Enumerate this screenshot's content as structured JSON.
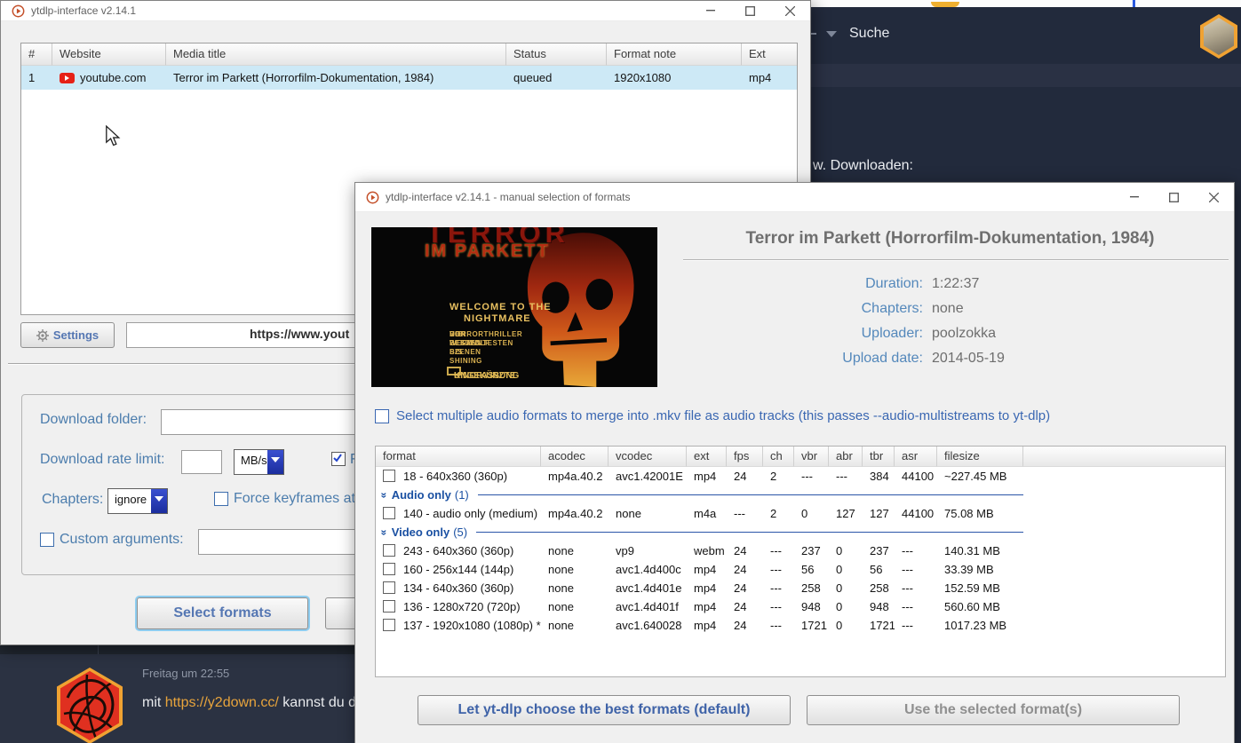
{
  "main_window": {
    "title": "ytdlp-interface v2.14.1",
    "queue_table": {
      "headers": [
        "#",
        "Website",
        "Media title",
        "Status",
        "Format note",
        "Ext"
      ],
      "rows": [
        {
          "num": "1",
          "website": "youtube.com",
          "title": "Terror im Parkett (Horrorfilm-Dokumentation, 1984)",
          "status": "queued",
          "format_note": "1920x1080",
          "ext": "mp4"
        }
      ]
    },
    "settings_button": "Settings",
    "url_fragment": "https://www.yout",
    "download_folder_label": "Download folder:",
    "rate_limit_label": "Download rate limit:",
    "rate_unit": "MB/s",
    "rate_checkbox_fragment": "F",
    "chapters_label": "Chapters:",
    "chapters_value": "ignore",
    "keyframes_label": "Force keyframes at c",
    "custom_args_label": "Custom arguments:",
    "select_formats_button": "Select formats"
  },
  "formats_window": {
    "title": "ytdlp-interface v2.14.1 - manual selection of formats",
    "video_title": "Terror im Parkett (Horrorfilm-Dokumentation, 1984)",
    "meta": [
      {
        "label": "Duration:",
        "value": "1:22:37"
      },
      {
        "label": "Chapters:",
        "value": "none"
      },
      {
        "label": "Uploader:",
        "value": "poolzokka"
      },
      {
        "label": "Upload date:",
        "value": "2014-05-19"
      }
    ],
    "multistream_checkbox": "Select multiple audio formats to merge into .mkv file as audio tracks (this passes --audio-multistreams to yt-dlp)",
    "table": {
      "headers": [
        "format",
        "acodec",
        "vcodec",
        "ext",
        "fps",
        "ch",
        "vbr",
        "abr",
        "tbr",
        "asr",
        "filesize"
      ],
      "rows": [
        {
          "type": "row",
          "format": "18 - 640x360 (360p)",
          "acodec": "mp4a.40.2",
          "vcodec": "avc1.42001E",
          "ext": "mp4",
          "fps": "24",
          "ch": "2",
          "vbr": "---",
          "abr": "---",
          "tbr": "384",
          "asr": "44100",
          "filesize": "~227.45 MB"
        },
        {
          "type": "group",
          "label": "Audio only",
          "count": "(1)"
        },
        {
          "type": "row",
          "format": "140 - audio only (medium) *",
          "acodec": "mp4a.40.2",
          "vcodec": "none",
          "ext": "m4a",
          "fps": "---",
          "ch": "2",
          "vbr": "0",
          "abr": "127",
          "tbr": "127",
          "asr": "44100",
          "filesize": "75.08 MB"
        },
        {
          "type": "group",
          "label": "Video only",
          "count": "(5)"
        },
        {
          "type": "row",
          "format": "243 - 640x360 (360p)",
          "acodec": "none",
          "vcodec": "vp9",
          "ext": "webm",
          "fps": "24",
          "ch": "---",
          "vbr": "237",
          "abr": "0",
          "tbr": "237",
          "asr": "---",
          "filesize": "140.31 MB"
        },
        {
          "type": "row",
          "format": "160 - 256x144 (144p)",
          "acodec": "none",
          "vcodec": "avc1.4d400c",
          "ext": "mp4",
          "fps": "24",
          "ch": "---",
          "vbr": "56",
          "abr": "0",
          "tbr": "56",
          "asr": "---",
          "filesize": "33.39 MB"
        },
        {
          "type": "row",
          "format": "134 - 640x360 (360p)",
          "acodec": "none",
          "vcodec": "avc1.4d401e",
          "ext": "mp4",
          "fps": "24",
          "ch": "---",
          "vbr": "258",
          "abr": "0",
          "tbr": "258",
          "asr": "---",
          "filesize": "152.59 MB"
        },
        {
          "type": "row",
          "format": "136 - 1280x720 (720p)",
          "acodec": "none",
          "vcodec": "avc1.4d401f",
          "ext": "mp4",
          "fps": "24",
          "ch": "---",
          "vbr": "948",
          "abr": "0",
          "tbr": "948",
          "asr": "---",
          "filesize": "560.60 MB"
        },
        {
          "type": "row",
          "format": "137 - 1920x1080 (1080p) *",
          "acodec": "none",
          "vcodec": "avc1.640028",
          "ext": "mp4",
          "fps": "24",
          "ch": "---",
          "vbr": "1721",
          "abr": "0",
          "tbr": "1721",
          "asr": "---",
          "filesize": "1017.23 MB"
        }
      ]
    },
    "btn_best": "Let yt-dlp choose the best formats (default)",
    "btn_use": "Use the selected format(s)"
  },
  "poster": {
    "title_top": "TERROR",
    "title_bottom": "IM PARKETT",
    "tagline1": "WELCOME TO THE",
    "tagline2": "NIGHTMARE",
    "info": [
      "DIE BESTEN SZENEN",
      "DER BEKANNTESTEN",
      "HORRORTHRILLER",
      "VON WERWOLF BIS SHINING"
    ],
    "box_line1": "UNGEKÜRZTE",
    "box_line2": "KINOFASSUNG"
  },
  "background": {
    "suche": "Suche",
    "downloaden": "w. Downloaden:",
    "chat_time": "Freitag um 22:55",
    "chat_msg_pre": "mit ",
    "chat_msg_link": "https://y2down.cc/",
    "chat_msg_post": " kannst du da"
  },
  "colors": {
    "accent_blue": "#4c7dad",
    "group_blue": "#1a50a2",
    "selection_blue": "#cde9f6",
    "discord_bg": "#2b3242",
    "browser_bg": "#222a3c",
    "hex_orange": "#f0a232",
    "link_orange": "#e8a43c",
    "youtube_red": "#e62117"
  }
}
